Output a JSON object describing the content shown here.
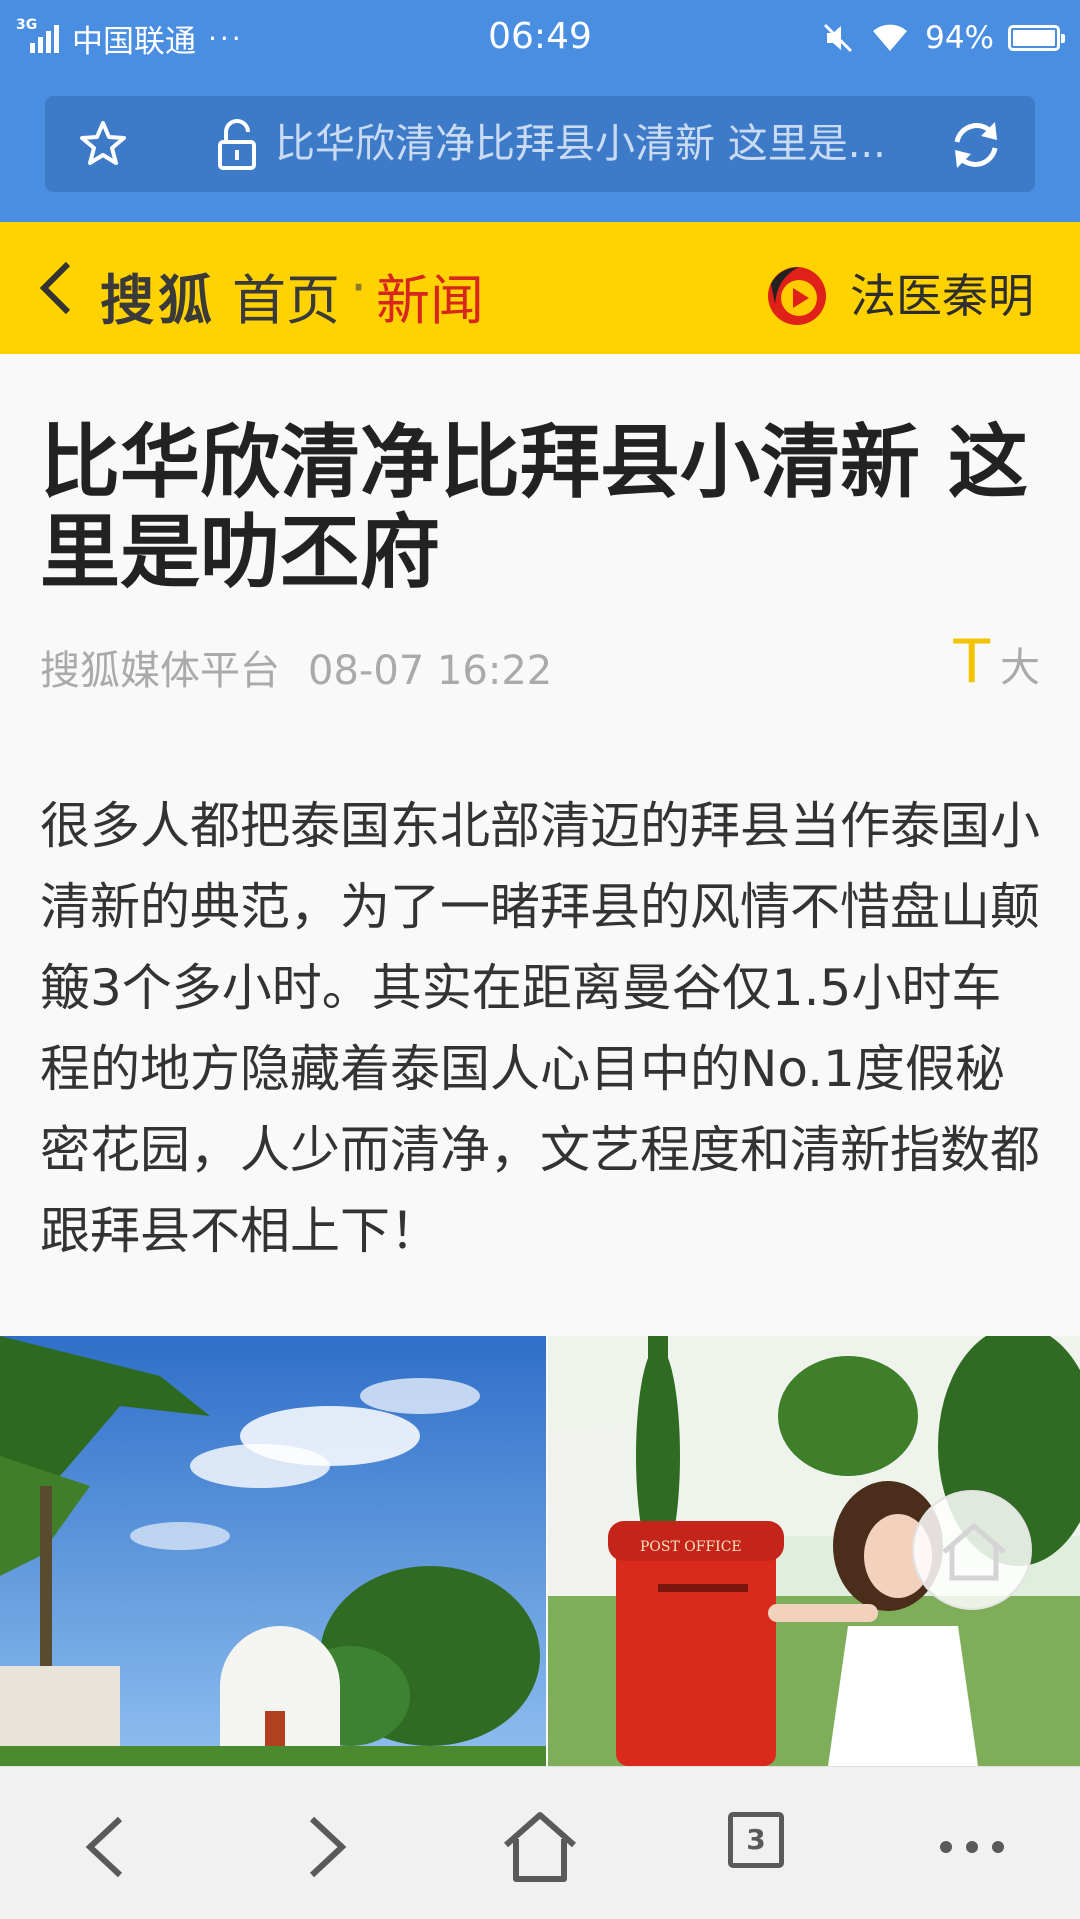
{
  "status_bar": {
    "network_type": "3G",
    "carrier": "中国联通",
    "more": "···",
    "time": "06:49",
    "battery": "94%"
  },
  "browser": {
    "url_title": "比华欣清净比拜县小清新 这里是..."
  },
  "site_header": {
    "site_name": "搜狐",
    "home_label": "首页",
    "separator": "·",
    "section": "新闻",
    "promo_label": "法医秦明"
  },
  "article": {
    "title": "比华欣清净比拜县小清新 这里是叻丕府",
    "source": "搜狐媒体平台",
    "date": "08-07 16:22",
    "font_icon": "T",
    "font_label": "大",
    "body": "很多人都把泰国东北部清迈的拜县当作泰国小清新的典范，为了一睹拜县的风情不惜盘山颠簸3个多小时。其实在距离曼谷仅1.5小时车程的地方隐藏着泰国人心目中的No.1度假秘密花园，人少而清净，文艺程度和清新指数都跟拜县不相上下！"
  },
  "images": {
    "post_box_text": "POST OFFICE"
  },
  "bottom_bar": {
    "tab_count": "3"
  },
  "colors": {
    "chrome_blue": "#4a8ee2",
    "url_bar_blue": "#3d7ac7",
    "sohu_yellow": "#ffd200",
    "news_red": "#d7261e",
    "font_t_yellow": "#f2c300"
  },
  "icons": [
    "signal-icon",
    "wifi-icon",
    "mute-icon",
    "battery-icon",
    "star-icon",
    "lock-icon",
    "refresh-icon",
    "chevron-left-icon",
    "play-logo-icon",
    "home-icon",
    "back-icon",
    "forward-icon",
    "more-icon"
  ]
}
